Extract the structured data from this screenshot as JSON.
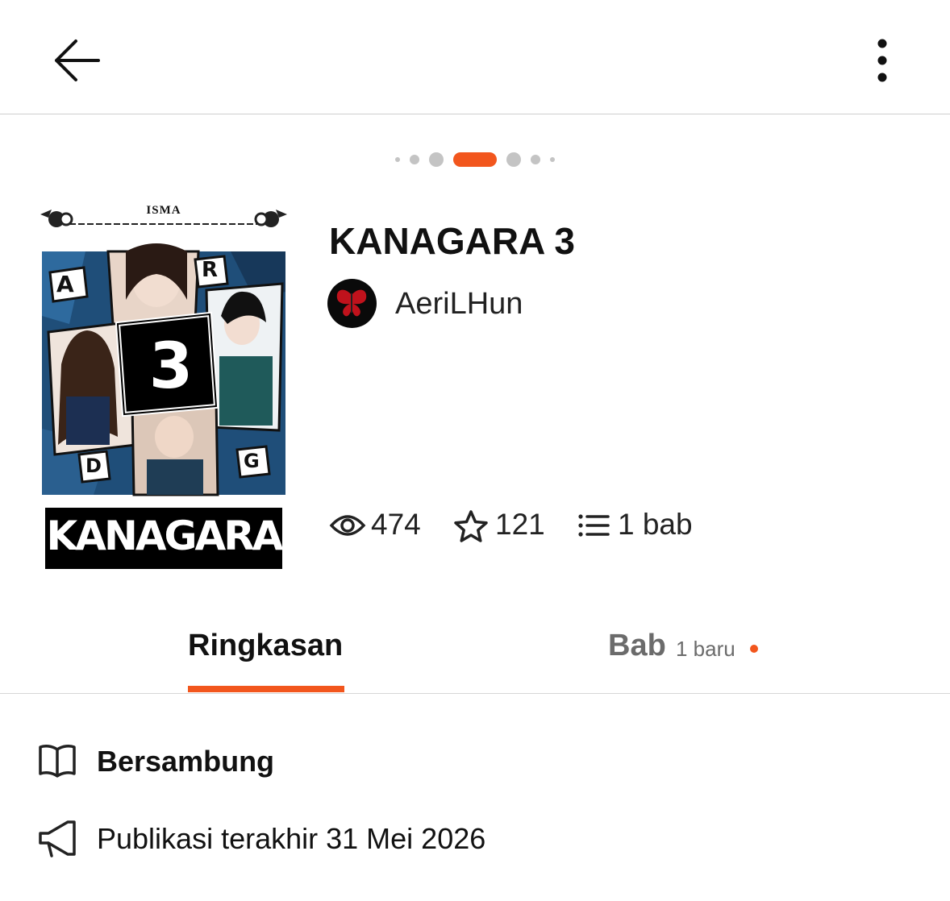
{
  "header": {
    "back_icon": "arrow-left-icon",
    "more_icon": "more-vertical-icon"
  },
  "carousel": {
    "total_dots": 7,
    "active_index": 3,
    "accent": "#f2561d"
  },
  "cover": {
    "author_label": "ISMA",
    "logo_text": "KANAGARA",
    "badge_number": "3",
    "letters": [
      "A",
      "R",
      "D",
      "G"
    ]
  },
  "story": {
    "title": "KANAGARA 3",
    "author": "AeriLHun",
    "avatar_icon": "butterfly-icon"
  },
  "stats": {
    "reads": "474",
    "votes": "121",
    "chapters": "1 bab"
  },
  "tabs": {
    "summary": "Ringkasan",
    "chapters": "Bab",
    "chapters_badge": "1 baru"
  },
  "details": {
    "status": "Bersambung",
    "last_published": "Publikasi terakhir 31 Mei 2026"
  },
  "colors": {
    "accent": "#f2561d",
    "muted": "#6b6b6b"
  }
}
